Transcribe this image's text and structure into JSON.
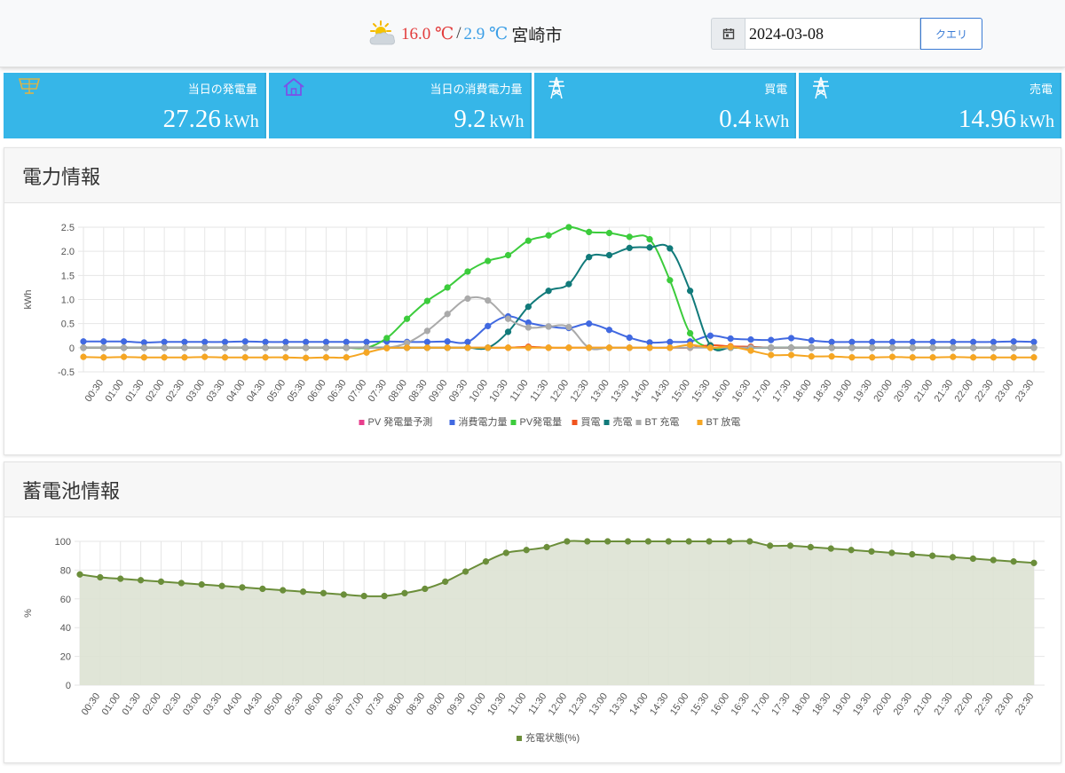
{
  "weather": {
    "icon": "partly-cloudy-icon",
    "temp_high": "16.0 ℃",
    "separator": "/",
    "temp_low": "2.9 ℃",
    "city": "宮崎市"
  },
  "query": {
    "date_value": "2024-03-08",
    "button_label": "クエリ",
    "calendar_icon": "calendar-icon"
  },
  "tiles": [
    {
      "label": "当日の発電量",
      "value": "27.26",
      "unit": "kWh",
      "icon": "solar-panel-icon"
    },
    {
      "label": "当日の消費電力量",
      "value": "9.2",
      "unit": "kWh",
      "icon": "home-icon"
    },
    {
      "label": "買電",
      "value": "0.4",
      "unit": "kWh",
      "icon": "power-tower-icon"
    },
    {
      "label": "売電",
      "value": "14.96",
      "unit": "kWh",
      "icon": "power-tower-icon"
    }
  ],
  "colors": {
    "tile_bg": "#36b6e8",
    "pv_forecast": "#e83e8c",
    "consumption": "#4169e1",
    "pv_generation": "#3ccc3c",
    "buy": "#f0541e",
    "sell": "#117a7a",
    "bt_charge": "#aaaaaa",
    "bt_discharge": "#f5a623",
    "soc": "#6b8e3a",
    "soc_fill": "#dde2d3"
  },
  "sections": {
    "power_title": "電力情報",
    "battery_title": "蓄電池情報"
  },
  "chart_data": [
    {
      "type": "line",
      "ylabel": "kWh",
      "ylim": [
        -0.5,
        2.5
      ],
      "yticks": [
        "2.5",
        "2.0",
        "1.5",
        "1.0",
        "0.5",
        "0",
        "-0.5"
      ],
      "x_tick_labels": [
        "00:30",
        "01:00",
        "01:30",
        "02:00",
        "02:30",
        "03:00",
        "03:30",
        "04:00",
        "04:30",
        "05:00",
        "05:30",
        "06:00",
        "06:30",
        "07:00",
        "07:30",
        "08:00",
        "08:30",
        "09:00",
        "09:30",
        "10:00",
        "10:30",
        "11:00",
        "11:30",
        "12:00",
        "12:30",
        "13:00",
        "13:30",
        "14:00",
        "14:30",
        "15:00",
        "15:30",
        "16:00",
        "16:30",
        "17:00",
        "17:30",
        "18:00",
        "18:30",
        "19:00",
        "19:30",
        "20:00",
        "20:30",
        "21:00",
        "21:30",
        "22:00",
        "22:30",
        "23:00",
        "23:30"
      ],
      "legend_position": "bottom",
      "grid": true,
      "series": [
        {
          "name": "PV 発電量予測",
          "values": []
        },
        {
          "name": "消費電力量",
          "values": [
            0.13,
            0.13,
            0.13,
            0.11,
            0.12,
            0.12,
            0.12,
            0.12,
            0.13,
            0.12,
            0.12,
            0.12,
            0.12,
            0.12,
            0.12,
            0.13,
            0.12,
            0.12,
            0.13,
            0.12,
            0.45,
            0.65,
            0.52,
            0.44,
            0.41,
            0.5,
            0.37,
            0.21,
            0.11,
            0.12,
            0.13,
            0.25,
            0.19,
            0.17,
            0.16,
            0.2,
            0.15,
            0.12,
            0.12,
            0.12,
            0.12,
            0.12,
            0.12,
            0.12,
            0.12,
            0.12,
            0.13,
            0.12
          ]
        },
        {
          "name": "PV発電量",
          "values": [
            0,
            0,
            0,
            0,
            0,
            0,
            0,
            0,
            0,
            0,
            0,
            0,
            0,
            0,
            0,
            0.2,
            0.6,
            0.97,
            1.25,
            1.58,
            1.8,
            1.92,
            2.22,
            2.33,
            2.5,
            2.4,
            2.38,
            2.3,
            2.25,
            1.4,
            0.3,
            0,
            0,
            0,
            0,
            0,
            0,
            0,
            0,
            0,
            0,
            0,
            0,
            0,
            0,
            0,
            0,
            0
          ]
        },
        {
          "name": "買電",
          "values": [
            0,
            0,
            0,
            0,
            0,
            0,
            0,
            0,
            0,
            0,
            0,
            0,
            0,
            0,
            0,
            0,
            0,
            0,
            0,
            0,
            0,
            0,
            0.02,
            0,
            0,
            0,
            0,
            0,
            0,
            0,
            0,
            0.05,
            0.03,
            0.02,
            0,
            0,
            0,
            0,
            0,
            0,
            0,
            0,
            0,
            0,
            0,
            0,
            0,
            0
          ]
        },
        {
          "name": "売電",
          "values": [
            0,
            0,
            0,
            0,
            0,
            0,
            0,
            0,
            0,
            0,
            0,
            0,
            0,
            0,
            0,
            0,
            0,
            0,
            0,
            0,
            0,
            0.33,
            0.85,
            1.18,
            1.32,
            1.88,
            1.92,
            2.07,
            2.08,
            2.06,
            1.18,
            0.05,
            0,
            0,
            0,
            0,
            0,
            0,
            0,
            0,
            0,
            0,
            0,
            0,
            0,
            0,
            0,
            0
          ]
        },
        {
          "name": "BT 充電",
          "values": [
            0,
            0,
            0,
            0,
            0,
            0,
            0,
            0,
            0,
            0,
            0,
            0,
            0,
            0,
            0,
            0,
            0.1,
            0.35,
            0.7,
            1.02,
            0.98,
            0.6,
            0.42,
            0.44,
            0.43,
            0,
            0,
            0,
            0,
            0,
            0,
            0,
            0,
            0,
            0,
            0,
            0,
            0,
            0,
            0,
            0,
            0,
            0,
            0,
            0,
            0,
            0,
            0
          ]
        },
        {
          "name": "BT 放電",
          "values": [
            -0.19,
            -0.2,
            -0.19,
            -0.2,
            -0.2,
            -0.2,
            -0.19,
            -0.2,
            -0.2,
            -0.2,
            -0.2,
            -0.21,
            -0.2,
            -0.2,
            -0.1,
            -0.01,
            0,
            0,
            0,
            0,
            0,
            0,
            0,
            0,
            0,
            0,
            0,
            0,
            0,
            0,
            0.06,
            0,
            0.02,
            -0.06,
            -0.15,
            -0.15,
            -0.18,
            -0.18,
            -0.2,
            -0.2,
            -0.19,
            -0.2,
            -0.2,
            -0.19,
            -0.2,
            -0.2,
            -0.2,
            -0.2
          ]
        }
      ]
    },
    {
      "type": "area",
      "ylabel": "%",
      "ylim": [
        0,
        100
      ],
      "yticks": [
        "100",
        "80",
        "60",
        "40",
        "20",
        "0"
      ],
      "x_tick_labels": [
        "00:30",
        "01:00",
        "01:30",
        "02:00",
        "02:30",
        "03:00",
        "03:30",
        "04:00",
        "04:30",
        "05:00",
        "05:30",
        "06:00",
        "06:30",
        "07:00",
        "07:30",
        "08:00",
        "08:30",
        "09:00",
        "09:30",
        "10:00",
        "10:30",
        "11:00",
        "11:30",
        "12:00",
        "12:30",
        "13:00",
        "13:30",
        "14:00",
        "14:30",
        "15:00",
        "15:30",
        "16:00",
        "16:30",
        "17:00",
        "17:30",
        "18:00",
        "18:30",
        "19:00",
        "19:30",
        "20:00",
        "20:30",
        "21:00",
        "21:30",
        "22:00",
        "22:30",
        "23:00",
        "23:30"
      ],
      "legend_position": "bottom",
      "grid": true,
      "series": [
        {
          "name": "充電状態(%)",
          "values": [
            77,
            75,
            74,
            73,
            72,
            71,
            70,
            69,
            68,
            67,
            66,
            65,
            64,
            63,
            62,
            62,
            64,
            67,
            72,
            79,
            86,
            92,
            94,
            96,
            100,
            100,
            100,
            100,
            100,
            100,
            100,
            100,
            100,
            100,
            97,
            97,
            96,
            95,
            94,
            93,
            92,
            91,
            90,
            89,
            88,
            87,
            86,
            85
          ]
        }
      ]
    }
  ]
}
